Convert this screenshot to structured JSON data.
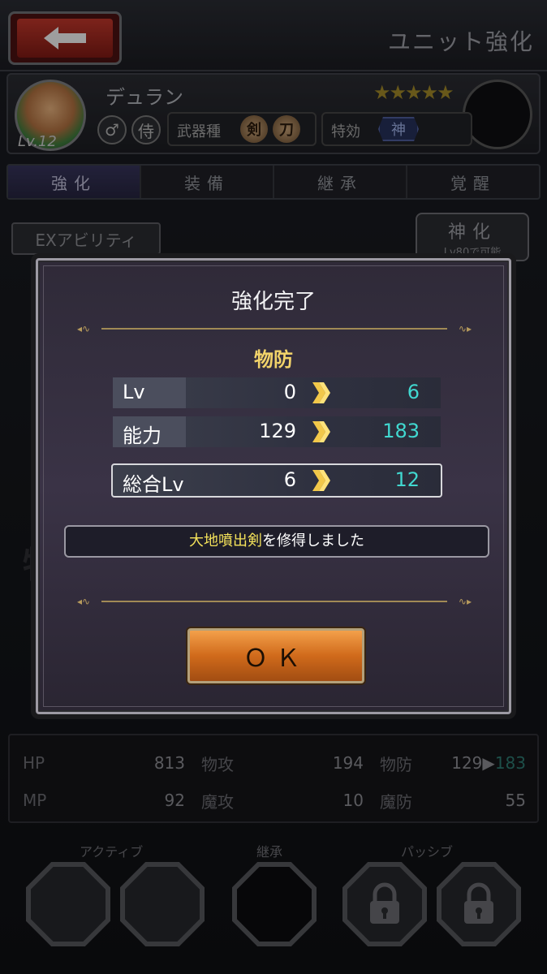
{
  "header": {
    "title": "ユニット強化"
  },
  "unit": {
    "name": "デュラン",
    "level": "Lv.12",
    "stars": "★★★★★",
    "gender_symbol": "♂",
    "class_symbol": "侍",
    "weapon_label": "武器種",
    "weapons": [
      "剣",
      "刀"
    ],
    "tokkou_label": "特効",
    "tokkou_tag": "神"
  },
  "tabs": [
    "強化",
    "装備",
    "継承",
    "覚醒"
  ],
  "ex_ability_label": "EXアビリティ",
  "shinka": {
    "title": "神化",
    "sub": "Lv80で可能"
  },
  "background_labels": {
    "left": "物攻",
    "right": "魔攻"
  },
  "stats": {
    "row1": [
      {
        "label": "HP",
        "value": "813"
      },
      {
        "label": "物攻",
        "value": "194"
      },
      {
        "label": "物防",
        "old": "129",
        "arrow": "▶",
        "new": "183"
      }
    ],
    "row2": [
      {
        "label": "MP",
        "value": "92"
      },
      {
        "label": "魔攻",
        "value": "10"
      },
      {
        "label": "魔防",
        "value": "55"
      }
    ]
  },
  "skills": {
    "active": "アクティブ",
    "inherit": "継承",
    "passive": "パッシブ"
  },
  "modal": {
    "title": "強化完了",
    "stat_name": "物防",
    "rows": [
      {
        "label": "Lv",
        "old": "0",
        "new": "6"
      },
      {
        "label": "能力",
        "old": "129",
        "new": "183"
      },
      {
        "label": "総合Lv",
        "old": "6",
        "new": "12"
      }
    ],
    "learned_skill": "大地噴出剣",
    "learned_suffix": "を修得しました",
    "ok_label": "ＯＫ"
  },
  "colors": {
    "accent_teal": "#41d8d0",
    "gold": "#f2d36a",
    "ok_orange": "#d06a1b"
  }
}
